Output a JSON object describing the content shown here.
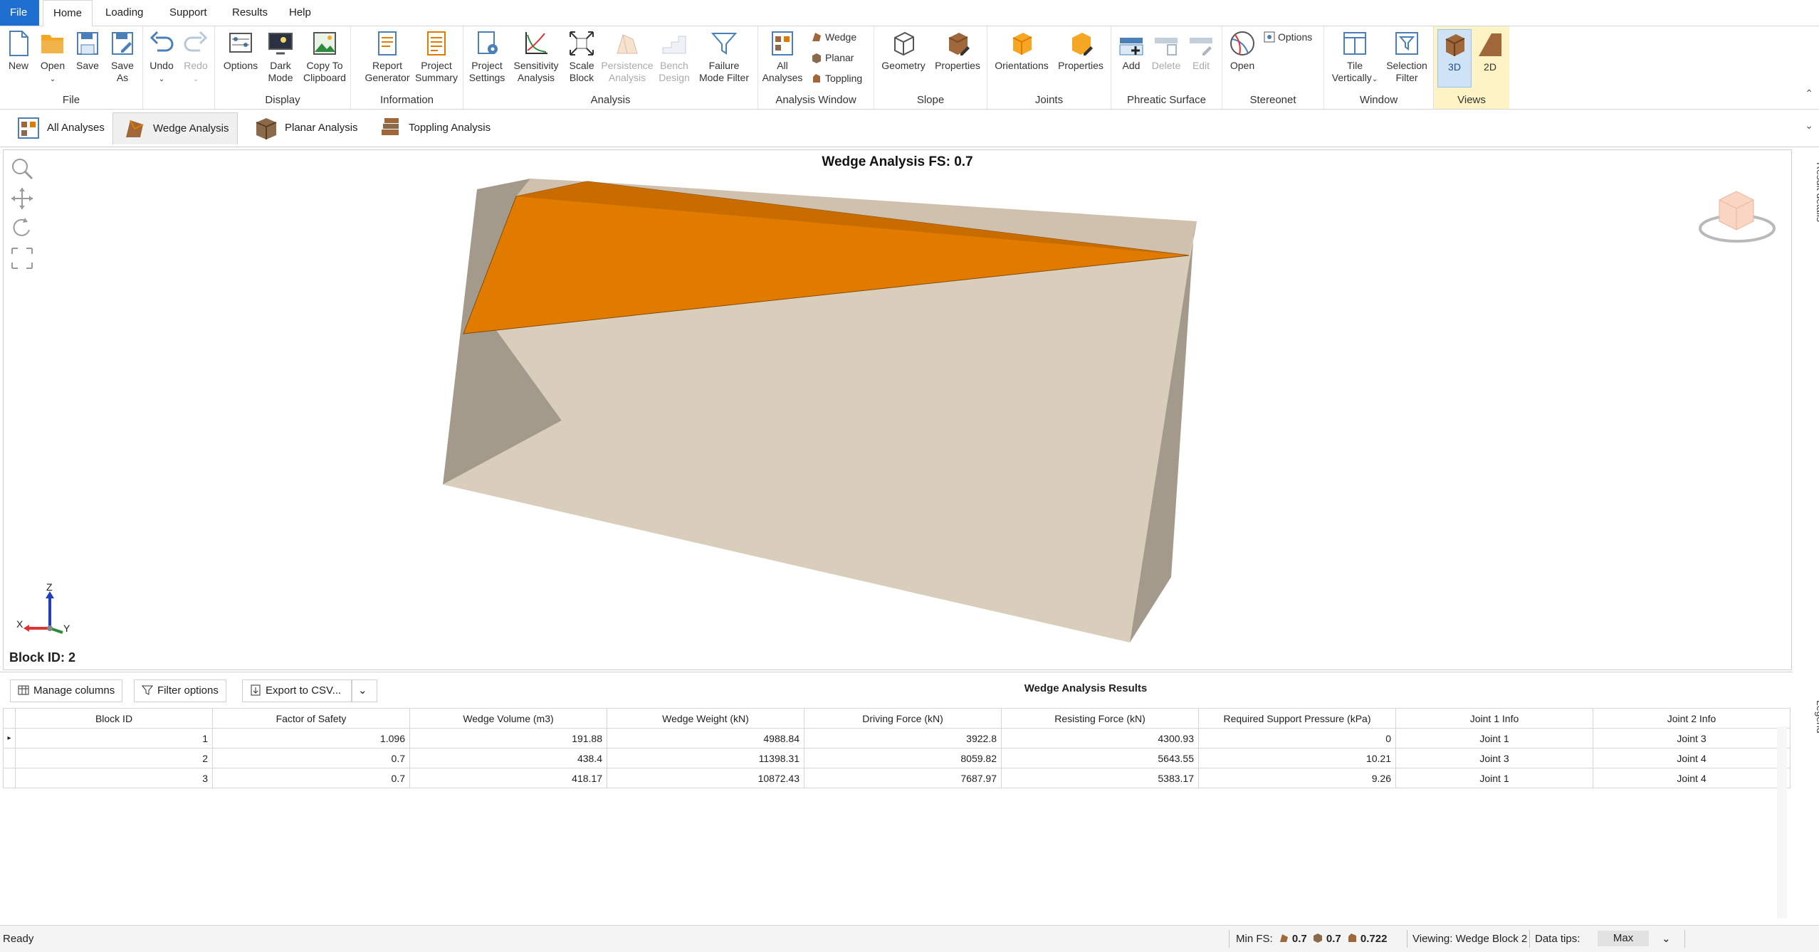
{
  "menu": {
    "file": "File",
    "home": "Home",
    "loading": "Loading",
    "support": "Support",
    "results": "Results",
    "help": "Help"
  },
  "ribbon": {
    "file_group": {
      "label": "File",
      "new": "New",
      "open": "Open",
      "save": "Save",
      "save_as_1": "Save",
      "save_as_2": "As"
    },
    "undo": "Undo",
    "redo": "Redo",
    "display_group": {
      "label": "Display",
      "options": "Options",
      "dark_mode_1": "Dark",
      "dark_mode_2": "Mode",
      "copy_1": "Copy To",
      "copy_2": "Clipboard"
    },
    "information_group": {
      "label": "Information",
      "report_1": "Report",
      "report_2": "Generator",
      "summary_1": "Project",
      "summary_2": "Summary"
    },
    "analysis_group": {
      "label": "Analysis",
      "project_settings_1": "Project",
      "project_settings_2": "Settings",
      "sensitivity_1": "Sensitivity",
      "sensitivity_2": "Analysis",
      "scale_1": "Scale",
      "scale_2": "Block",
      "persistence_1": "Persistence",
      "persistence_2": "Analysis",
      "bench_1": "Bench",
      "bench_2": "Design",
      "failure_1": "Failure",
      "failure_2": "Mode Filter"
    },
    "analysis_window_group": {
      "label": "Analysis Window",
      "all_1": "All",
      "all_2": "Analyses",
      "wedge": "Wedge",
      "planar": "Planar",
      "toppling": "Toppling"
    },
    "slope_group": {
      "label": "Slope",
      "geometry": "Geometry",
      "properties": "Properties"
    },
    "joints_group": {
      "label": "Joints",
      "orientations": "Orientations",
      "properties": "Properties"
    },
    "phreatic_group": {
      "label": "Phreatic Surface",
      "add": "Add",
      "delete": "Delete",
      "edit": "Edit"
    },
    "stereonet_group": {
      "label": "Stereonet",
      "open": "Open",
      "options": "Options"
    },
    "window_group": {
      "label": "Window",
      "tile_1": "Tile",
      "tile_2": "Vertically",
      "selection_1": "Selection",
      "selection_2": "Filter"
    },
    "views_group": {
      "label": "Views",
      "v3d": "3D",
      "v2d": "2D"
    }
  },
  "tabs": [
    {
      "label": "All Analyses"
    },
    {
      "label": "Wedge Analysis"
    },
    {
      "label": "Planar Analysis"
    },
    {
      "label": "Toppling Analysis"
    }
  ],
  "view": {
    "title": "Wedge Analysis FS: 0.7",
    "block_id": "Block ID: 2",
    "side_tab": "Result details",
    "legend_tab": "Legend",
    "axis_z": "Z",
    "axis_x": "X",
    "axis_y": "Y"
  },
  "colors": {
    "wedge": "#e07b00",
    "slope_face": "#d9cdbb",
    "slope_side": "#a49a8c",
    "accent": "#1f6fd1"
  },
  "results": {
    "manage_columns": "Manage columns",
    "filter_options": "Filter options",
    "export_csv": "Export to CSV...",
    "title": "Wedge Analysis Results",
    "columns": [
      "Block ID",
      "Factor of Safety",
      "Wedge Volume (m3)",
      "Wedge Weight (kN)",
      "Driving Force (kN)",
      "Resisting Force (kN)",
      "Required Support Pressure (kPa)",
      "Joint 1 Info",
      "Joint 2 Info"
    ],
    "rows": [
      [
        "1",
        "1.096",
        "191.88",
        "4988.84",
        "3922.8",
        "4300.93",
        "0",
        "Joint 1",
        "Joint 3"
      ],
      [
        "2",
        "0.7",
        "438.4",
        "11398.31",
        "8059.82",
        "5643.55",
        "10.21",
        "Joint 3",
        "Joint 4"
      ],
      [
        "3",
        "0.7",
        "418.17",
        "10872.43",
        "7687.97",
        "5383.17",
        "9.26",
        "Joint 1",
        "Joint 4"
      ]
    ]
  },
  "status": {
    "ready": "Ready",
    "min_fs": "Min FS:",
    "fs1": "0.7",
    "fs2": "0.7",
    "fs3": "0.722",
    "viewing": "Viewing: Wedge Block 2",
    "data_tips": "Data tips:",
    "data_tips_value": "Max"
  }
}
